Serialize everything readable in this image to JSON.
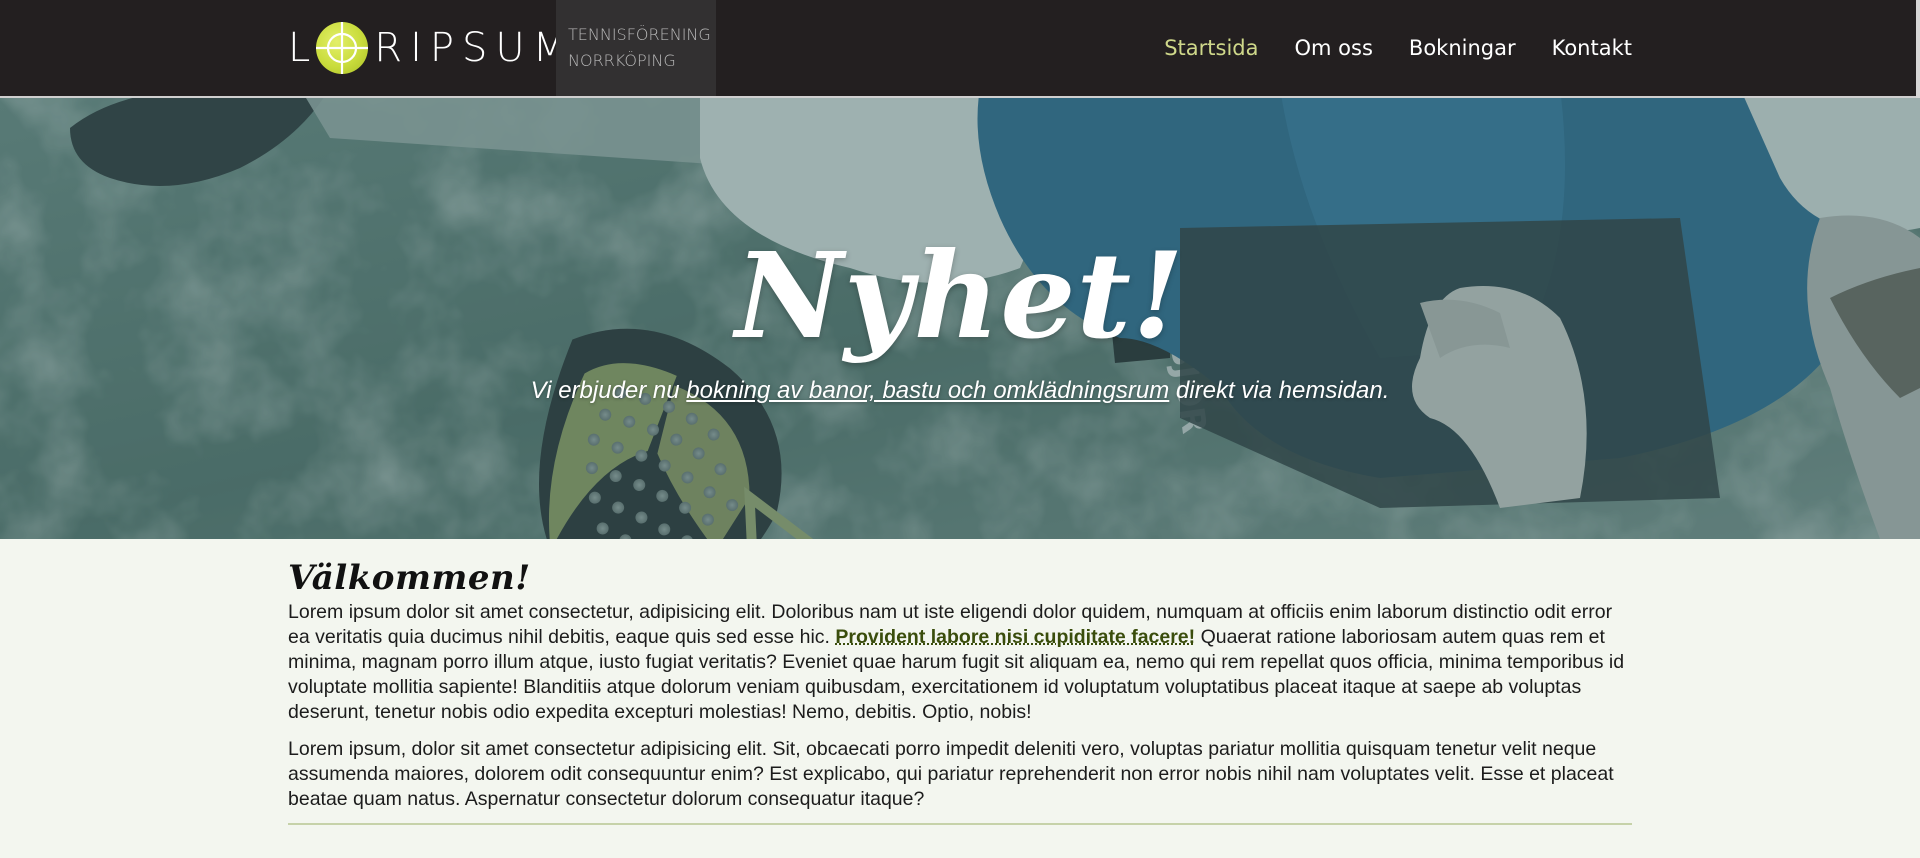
{
  "header": {
    "logo_first_letter": "L",
    "logo_rest": "RIPSUM",
    "tagline_line1": "TENNISFÖRENING",
    "tagline_line2": "NORRKÖPING",
    "nav": [
      {
        "label": "Startsida",
        "active": true
      },
      {
        "label": "Om oss",
        "active": false
      },
      {
        "label": "Bokningar",
        "active": false
      },
      {
        "label": "Kontakt",
        "active": false
      }
    ]
  },
  "hero": {
    "title": "Nyhet!",
    "subtitle_before": "Vi erbjuder nu ",
    "subtitle_link": "bokning av banor, bastu och omklädningsrum",
    "subtitle_after": " direkt via hemsidan."
  },
  "content": {
    "heading": "Välkommen!",
    "p1_before": "Lorem ipsum dolor sit amet consectetur, adipisicing elit. Doloribus nam ut iste eligendi dolor quidem, numquam at officiis enim laborum distinctio odit error ea veritatis quia ducimus nihil debitis, eaque quis sed esse hic. ",
    "p1_link": "Provident labore nisi cupiditate facere!",
    "p1_after": " Quaerat ratione laboriosam autem quas rem et minima, magnam porro illum atque, iusto fugiat veritatis? Eveniet quae harum fugit sit aliquam ea, nemo qui rem repellat quos officia, minima temporibus id voluptate mollitia sapiente! Blanditiis atque dolorum veniam quibusdam, exercitationem id voluptatum voluptatibus placeat itaque at saepe ab voluptas deserunt, tenetur nobis odio expedita excepturi molestias! Nemo, debitis. Optio, nobis!",
    "p2": "Lorem ipsum, dolor sit amet consectetur adipisicing elit. Sit, obcaecati porro impedit deleniti vero, voluptas pariatur mollitia quisquam tenetur velit neque assumenda maiores, dolorem odit consequuntur enim? Est explicabo, qui pariatur reprehenderit non error nobis nihil nam voluptates velit. Esse et placeat beatae quam natus. Aspernatur consectetur dolorum consequatur itaque?"
  },
  "colors": {
    "header_bg": "#231f20",
    "tagline_bg": "#323031",
    "nav_active": "#cfd88a",
    "ball": "#c9dc3c",
    "page_bg": "#f3f6ef",
    "link": "#3a4d0c"
  }
}
